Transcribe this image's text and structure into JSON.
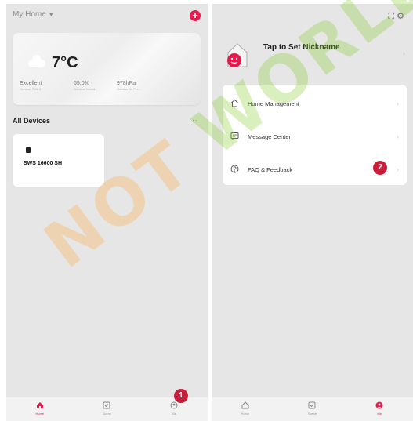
{
  "left_screen": {
    "home_selector": "My Home",
    "weather": {
      "temperature": "7°C",
      "metrics": [
        {
          "value": "Excellent",
          "label": "Outdoor PM2.5"
        },
        {
          "value": "65.0%",
          "label": "Outdoor Humid..."
        },
        {
          "value": "978hPa",
          "label": "Outdoor Air Pre..."
        }
      ]
    },
    "section_title": "All Devices",
    "device": {
      "name": "SWS 16600 SH"
    },
    "tabs": [
      {
        "label": "Home",
        "icon": "home-icon",
        "active": true
      },
      {
        "label": "Scene",
        "icon": "scene-icon",
        "active": false
      },
      {
        "label": "Me",
        "icon": "me-icon",
        "active": false
      }
    ],
    "step_badge": "1"
  },
  "right_screen": {
    "nickname": "Tap to Set Nickname",
    "menu": [
      {
        "label": "Home Management",
        "icon": "house-icon"
      },
      {
        "label": "Message Center",
        "icon": "message-icon"
      },
      {
        "label": "FAQ & Feedback",
        "icon": "help-icon"
      }
    ],
    "tabs": [
      {
        "label": "Home",
        "icon": "home-icon",
        "active": false
      },
      {
        "label": "Scene",
        "icon": "scene-icon",
        "active": false
      },
      {
        "label": "Me",
        "icon": "me-icon",
        "active": true
      }
    ],
    "step_badge": "2"
  },
  "watermark": {
    "part1": "NOT ",
    "part2": "WORLD"
  },
  "colors": {
    "accent": "#e8194a",
    "badge": "#c8203b",
    "screen_bg": "#e6e6e6",
    "card_bg": "#ffffff",
    "watermark_green": "#82cd28",
    "watermark_orange": "#ffaa3c"
  }
}
